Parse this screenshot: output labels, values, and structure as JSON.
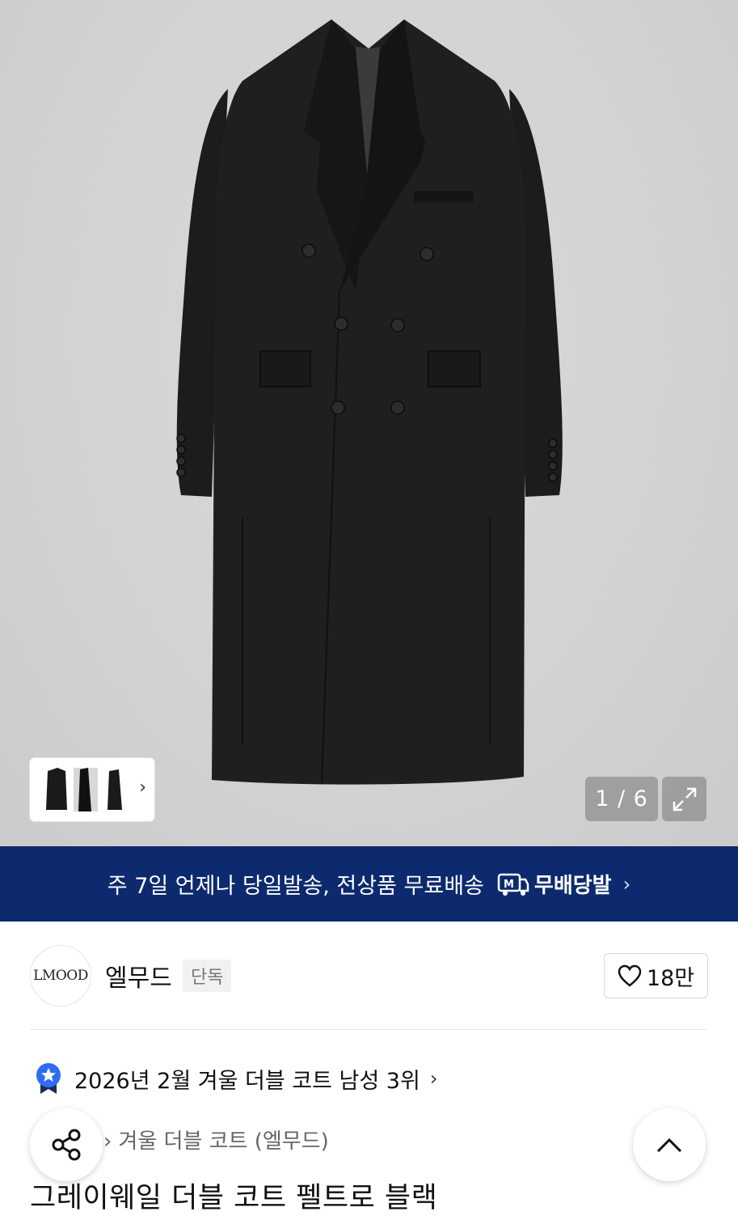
{
  "gallery": {
    "counter": "1 / 6",
    "thumb_more": "›",
    "expand_icon": "expand-icon"
  },
  "banner": {
    "text": "주 7일 언제나 당일발송, 전상품 무료배송",
    "badge": "무배당발",
    "arrow": "›",
    "bg_color": "#0d2a6e"
  },
  "brand": {
    "logo_text": "LMOOD",
    "name": "엘무드",
    "tag": "단독",
    "likes": "18만"
  },
  "ranking": {
    "text": "2026년 2월 겨울 더블 코트 남성 3위",
    "chevron": "›"
  },
  "breadcrumb": {
    "separator": "›",
    "category": "겨울 더블 코트 (엘무드)"
  },
  "product": {
    "title": "그레이웨일 더블 코트 펠트로 블랙"
  }
}
